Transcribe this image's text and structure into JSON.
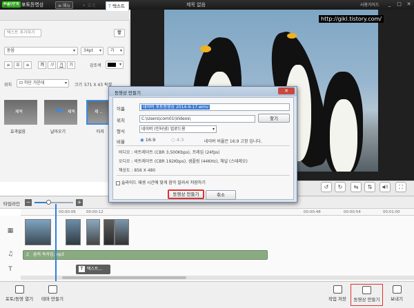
{
  "titlebar": {
    "logo": "NAVER",
    "app_name": "포토동영상",
    "menu_label": "메뉴",
    "doc_title": "제목 없음",
    "guide_label": "사용가이드",
    "minimize": "_",
    "maximize": "□",
    "close": "✕"
  },
  "tabs": [
    {
      "icon": "video-icon",
      "label": "동영상"
    },
    {
      "icon": "photo-icon",
      "label": "사진"
    },
    {
      "icon": "music-icon",
      "label": "음악"
    },
    {
      "icon": "effect-icon",
      "label": "효과"
    },
    {
      "icon": "text-icon",
      "label": "텍스트"
    }
  ],
  "text_panel": {
    "add_text_label": "텍스트 추가하기",
    "font_value": "돋움",
    "font_size": "34pt",
    "font_style": "가",
    "format_buttons": [
      "≡",
      "☰",
      "≡",
      "가",
      "가",
      "가",
      "가"
    ],
    "stroke_label": "강조색",
    "position_label": "위치",
    "position_value": "하단 가운데",
    "size_label": "크기",
    "size_value": "571 X 43 픽셀",
    "animations": [
      {
        "thumb_text": "제목",
        "label": "효과없음"
      },
      {
        "thumb_text": "제목",
        "label": "날아오기"
      },
      {
        "thumb_text": "제 ..",
        "label": "타자"
      }
    ]
  },
  "preview": {
    "watermark_url": "http://gikl.tistory.com/"
  },
  "playback": {
    "buttons": [
      "↺",
      "↻",
      "⇆",
      "⇅",
      "◀))",
      "⛶"
    ]
  },
  "timeline": {
    "label": "타임라인",
    "zoom_out": "−",
    "zoom_in": "+",
    "ticks": [
      "00:00:06",
      "00:00:12",
      "00:00:48",
      "00:00:54",
      "00:01:00"
    ],
    "music_clip": "숨의 속삭임.mp3",
    "text_clip": "텍스트...",
    "zoom_level": 0.35
  },
  "bottom_toolbar": {
    "left": [
      {
        "icon": "open-icon",
        "label": "포토/동영 열기"
      },
      {
        "icon": "theme-icon",
        "label": "테마 만들기"
      }
    ],
    "right": [
      {
        "icon": "save-icon",
        "label": "작업 저장"
      },
      {
        "icon": "make-video-icon",
        "label": "동영상 만들기"
      },
      {
        "icon": "send-icon",
        "label": "보내기"
      }
    ],
    "highlight_color": "#e03030"
  },
  "dialog": {
    "title": "동영상 만들기",
    "close": "✕",
    "name_label": "이름",
    "name_value": "네이버 포토동영상 2014-9-17.wmv",
    "location_label": "위치",
    "location_value": "C:\\Users\\com01\\Videos\\",
    "browse_label": "찾기",
    "format_label": "형식",
    "format_value": "네이버 (인터넷) 업로드용",
    "ratio_label": "비율",
    "ratio_169": "16:9",
    "ratio_43": "4:3",
    "ratio_note": "네이버 비율은 16:9 고정 입니다.",
    "video_info": "비디오 : 비트레이트 (CBR 3,500Kbps), 프레임 (24fps)",
    "audio_info": "오디오 : 비트레이트 (CBR 192Kbps), 샘플링 (44KHz), 채널 (스테레오)",
    "resolution_info": "해상도 : 856 X 480",
    "slide_checkbox": "슬라이드 재생 시간에 맞게 음악 잘라서 저장하기",
    "make_button": "동영상 만들기",
    "cancel_button": "취소",
    "accent": "#3a7bd5",
    "highlight_color": "#e03030"
  }
}
